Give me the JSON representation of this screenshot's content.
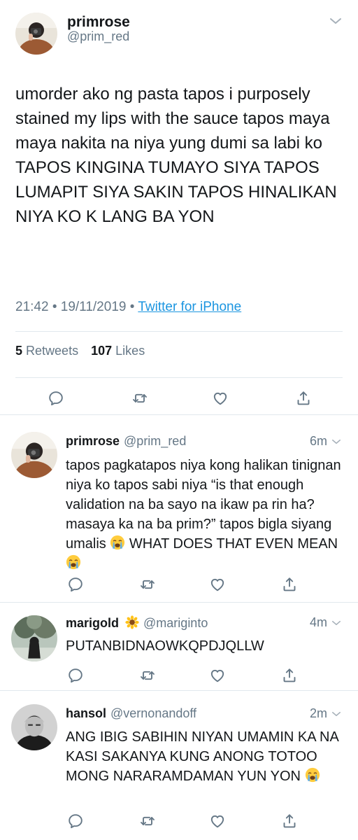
{
  "main_tweet": {
    "name": "primrose",
    "handle": "@prim_red",
    "text": "umorder ako ng pasta tapos i purposely stained my lips with the sauce tapos maya maya nakita na niya yung dumi sa labi ko TAPOS KINGINA TUMAYO SIYA TAPOS LUMAPIT SIYA SAKIN TAPOS HINALIKAN NIYA KO K LANG BA YON",
    "time": "21:42",
    "date": "19/11/2019",
    "source": "Twitter for iPhone",
    "retweets_count": "5",
    "retweets_label": "Retweets",
    "likes_count": "107",
    "likes_label": "Likes"
  },
  "replies": [
    {
      "name": "primrose",
      "handle": "@prim_red",
      "time": "6m",
      "text_parts": [
        "tapos pagkatapos niya kong halikan tinignan niya ko tapos sabi niya “is that enough validation na ba sayo na ikaw pa rin ha? masaya ka na ba prim?” tapos bigla siyang umalis ",
        " WHAT DOES THAT EVEN MEAN ",
        ""
      ]
    },
    {
      "name": "marigold",
      "handle": "@mariginto",
      "time": "4m",
      "text": "PUTANBIDNAOWKQPDJQLLW"
    },
    {
      "name": "hansol",
      "handle": "@vernonandoff",
      "time": "2m",
      "text": "ANG IBIG SABIHIN NIYAN UMAMIN KA NA KASI SAKANYA KUNG ANONG TOTOO MONG NARARAMDAMAN YUN YON "
    }
  ],
  "icons": {
    "reply": "reply-icon",
    "retweet": "retweet-icon",
    "like": "heart-icon",
    "share": "share-icon",
    "crying": "loudly-crying-face-emoji",
    "sunflower": "sunflower-emoji",
    "more": "chevron-down-icon"
  },
  "colors": {
    "text": "#14171a",
    "secondary": "#657786",
    "link": "#1b95e0",
    "divider": "#e1e8ed"
  }
}
